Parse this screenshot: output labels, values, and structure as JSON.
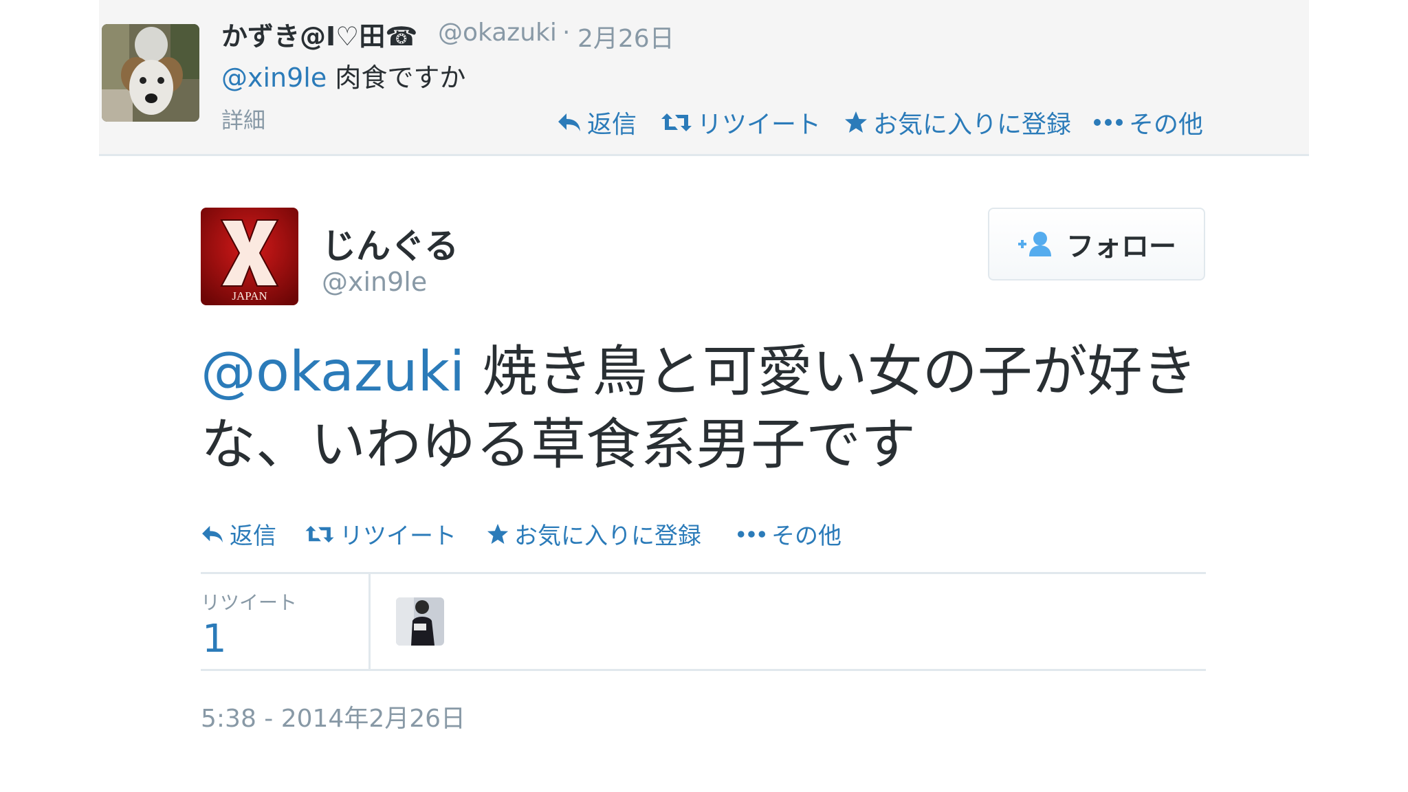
{
  "parent_tweet": {
    "display_name": "かずき@I♡田☎",
    "handle": "@okazuki",
    "separator": "·",
    "date": "2月26日",
    "mention": "@xin9le",
    "text": " 肉食ですか",
    "details": "詳細",
    "actions": {
      "reply": "返信",
      "retweet": "リツイート",
      "favorite": "お気に入りに登録",
      "more": "その他"
    }
  },
  "main_tweet": {
    "display_name": "じんぐる",
    "handle": "@xin9le",
    "follow_label": "フォロー",
    "avatar_text": "JAPAN",
    "mention": "@okazuki",
    "text": " 焼き鳥と可愛い女の子が好きな、いわゆる草食系男子です",
    "actions": {
      "reply": "返信",
      "retweet": "リツイート",
      "favorite": "お気に入りに登録",
      "more": "その他"
    },
    "stats": {
      "retweets_label": "リツイート",
      "retweets_count": "1"
    },
    "timestamp": "5:38 - 2014年2月26日"
  },
  "colors": {
    "link": "#2b7bb9",
    "muted": "#8899a6",
    "text": "#292f33",
    "border": "#e1e8ed"
  },
  "icons": [
    "reply-icon",
    "retweet-icon",
    "star-icon",
    "more-icon",
    "follow-person-icon"
  ]
}
